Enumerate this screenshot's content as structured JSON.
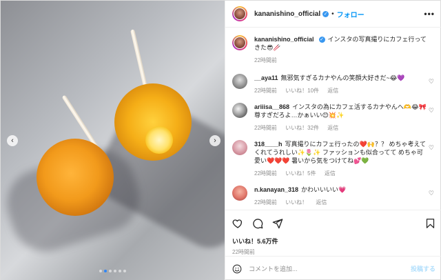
{
  "post": {
    "username": "kananishino_official",
    "separator": "•",
    "follow_label": "フォロー",
    "more_label": "•••"
  },
  "caption": {
    "username": "kananishino_official",
    "text": "インスタの写真撮りにカフェ行ってきた😎🥢",
    "time": "22時間前"
  },
  "comments": [
    {
      "username": "__aya11",
      "text": "無邪気すぎるカナやんの笑顔大好きだ~😂💜",
      "time": "22時間前",
      "likes": "いいね！10件",
      "reply": "返信"
    },
    {
      "username": "ariiisa__868",
      "text": "インスタの為にカフェ活するカナやんへ🫶😂🎀 尊すぎだろよ…かぁいい😊💥✨",
      "time": "22時間前",
      "likes": "いいね！32件",
      "reply": "返信"
    },
    {
      "username": "318____h",
      "text": "写真撮りにカフェ行ったの❤️🙌？？ めちゃ考えてくれてうれしい✨🌷✨ ファッションも似合ってて めちゃ可愛い❤️❤️❤️ 暑いから気をつけてね💕💚",
      "time": "22時間前",
      "likes": "いいね！5件",
      "reply": "返信"
    },
    {
      "username": "n.kanayan_318",
      "text": "かわいいいい💗",
      "time": "22時間前",
      "likes": "いいね！",
      "reply": "返信"
    }
  ],
  "engagement": {
    "likes": "いいね！5.6万件",
    "time": "22時間前"
  },
  "comment_box": {
    "placeholder": "コメントを追加...",
    "post_label": "投稿する"
  },
  "carousel": {
    "left_arrow": "‹",
    "right_arrow": "›",
    "slide_count": 6,
    "active_index": 1
  },
  "colors": {
    "accent": "#0095f6",
    "verified": "#3897f0",
    "muted": "#8e8e8e",
    "post_button_disabled": "#b2dffc"
  },
  "icons": [
    "verified-icon",
    "heart-icon",
    "comment-icon",
    "share-icon",
    "bookmark-icon",
    "emoji-icon",
    "chevron-left-icon",
    "chevron-right-icon"
  ]
}
